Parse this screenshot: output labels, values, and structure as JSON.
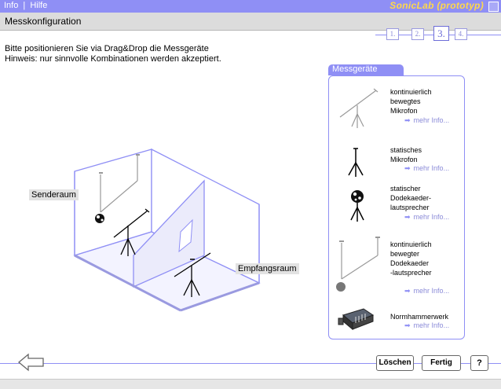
{
  "topbar": {
    "menu_info": "Info",
    "menu_sep": "|",
    "menu_help": "Hilfe",
    "brand": "SonicLab (prototyp)"
  },
  "titlebar": {
    "title": "Messkonfiguration"
  },
  "steps": [
    "1.",
    "2.",
    "3.",
    "4."
  ],
  "active_step": 3,
  "instructions": {
    "line1": "Bitte positionieren Sie via Drag&Drop die Messgeräte",
    "line2": "Hinweis: nur sinnvolle Kombinationen werden akzeptiert."
  },
  "rooms": {
    "sender": "Senderaum",
    "receiver": "Empfangsraum"
  },
  "panel": {
    "title": "Messgeräte",
    "more_label": "mehr Info...",
    "items": [
      {
        "label_lines": [
          "kontinuierlich",
          "bewegtes",
          "Mikrofon"
        ],
        "icon": "moving-microphone-icon"
      },
      {
        "label_lines": [
          "statisches",
          "Mikrofon"
        ],
        "icon": "static-microphone-icon"
      },
      {
        "label_lines": [
          "statischer",
          "Dodekaeder-",
          "lautsprecher"
        ],
        "icon": "static-dodecahedron-speaker-icon"
      },
      {
        "label_lines": [
          "kontinuierlich",
          "bewegter",
          "Dodekaeder",
          "-lautsprecher"
        ],
        "icon": "moving-dodecahedron-speaker-icon"
      },
      {
        "label_lines": [
          "Normhammerwerk"
        ],
        "icon": "tapping-machine-icon"
      }
    ]
  },
  "buttons": {
    "delete": "Löschen",
    "done": "Fertig",
    "help": "?"
  },
  "colors": {
    "accent": "#8f8ff5",
    "brand": "#ffd84a",
    "link": "#8a8ad8"
  }
}
